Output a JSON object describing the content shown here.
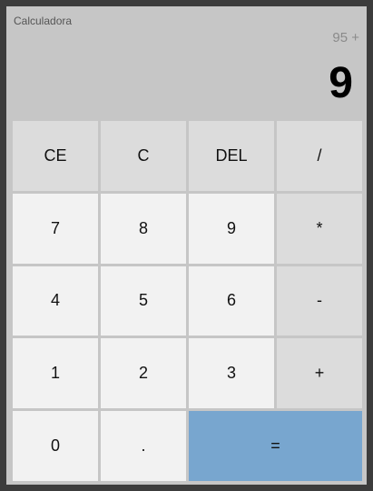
{
  "app": {
    "title": "Calculadora"
  },
  "display": {
    "expression": "95 +",
    "result": "9"
  },
  "keys": {
    "ce": "CE",
    "c": "C",
    "del": "DEL",
    "divide": "/",
    "seven": "7",
    "eight": "8",
    "nine": "9",
    "multiply": "*",
    "four": "4",
    "five": "5",
    "six": "6",
    "minus": "-",
    "one": "1",
    "two": "2",
    "three": "3",
    "plus": "+",
    "zero": "0",
    "dot": ".",
    "equals": "="
  },
  "colors": {
    "background": "#c6c6c6",
    "key_number": "#f2f2f2",
    "key_function": "#dcdcdc",
    "key_equals": "#78a6cf"
  }
}
